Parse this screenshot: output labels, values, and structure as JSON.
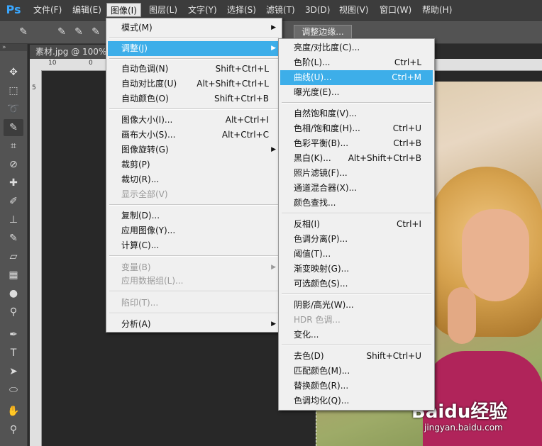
{
  "menubar": {
    "logo": "Ps",
    "items": [
      {
        "label": "文件(F)"
      },
      {
        "label": "编辑(E)"
      },
      {
        "label": "图像(I)"
      },
      {
        "label": "图层(L)"
      },
      {
        "label": "文字(Y)"
      },
      {
        "label": "选择(S)"
      },
      {
        "label": "滤镜(T)"
      },
      {
        "label": "3D(D)"
      },
      {
        "label": "视图(V)"
      },
      {
        "label": "窗口(W)"
      },
      {
        "label": "帮助(H)"
      }
    ]
  },
  "options": {
    "refine_edge": "调整边缘..."
  },
  "document": {
    "tab_label": "素材.jpg @ 100%(",
    "ruler_ticks": [
      "10",
      "0",
      "5"
    ]
  },
  "image_menu": {
    "items": [
      {
        "label": "模式(M)",
        "shortcut": "",
        "submenu": true
      },
      {
        "label": "调整(J)",
        "shortcut": "",
        "submenu": true
      },
      {
        "label": "自动色调(N)",
        "shortcut": "Shift+Ctrl+L"
      },
      {
        "label": "自动对比度(U)",
        "shortcut": "Alt+Shift+Ctrl+L"
      },
      {
        "label": "自动颜色(O)",
        "shortcut": "Shift+Ctrl+B"
      },
      {
        "label": "图像大小(I)...",
        "shortcut": "Alt+Ctrl+I"
      },
      {
        "label": "画布大小(S)...",
        "shortcut": "Alt+Ctrl+C"
      },
      {
        "label": "图像旋转(G)",
        "shortcut": "",
        "submenu": true
      },
      {
        "label": "裁剪(P)",
        "shortcut": ""
      },
      {
        "label": "裁切(R)...",
        "shortcut": ""
      },
      {
        "label": "显示全部(V)",
        "shortcut": ""
      },
      {
        "label": "复制(D)...",
        "shortcut": ""
      },
      {
        "label": "应用图像(Y)...",
        "shortcut": ""
      },
      {
        "label": "计算(C)...",
        "shortcut": ""
      },
      {
        "label": "变量(B)",
        "shortcut": "",
        "submenu": true
      },
      {
        "label": "应用数据组(L)...",
        "shortcut": ""
      },
      {
        "label": "陷印(T)...",
        "shortcut": ""
      },
      {
        "label": "分析(A)",
        "shortcut": "",
        "submenu": true
      }
    ]
  },
  "adjust_menu": {
    "items": [
      {
        "label": "亮度/对比度(C)...",
        "shortcut": ""
      },
      {
        "label": "色阶(L)...",
        "shortcut": "Ctrl+L"
      },
      {
        "label": "曲线(U)...",
        "shortcut": "Ctrl+M"
      },
      {
        "label": "曝光度(E)...",
        "shortcut": ""
      },
      {
        "label": "自然饱和度(V)...",
        "shortcut": ""
      },
      {
        "label": "色相/饱和度(H)...",
        "shortcut": "Ctrl+U"
      },
      {
        "label": "色彩平衡(B)...",
        "shortcut": "Ctrl+B"
      },
      {
        "label": "黑白(K)...",
        "shortcut": "Alt+Shift+Ctrl+B"
      },
      {
        "label": "照片滤镜(F)...",
        "shortcut": ""
      },
      {
        "label": "通道混合器(X)...",
        "shortcut": ""
      },
      {
        "label": "颜色查找...",
        "shortcut": ""
      },
      {
        "label": "反相(I)",
        "shortcut": "Ctrl+I"
      },
      {
        "label": "色调分离(P)...",
        "shortcut": ""
      },
      {
        "label": "阈值(T)...",
        "shortcut": ""
      },
      {
        "label": "渐变映射(G)...",
        "shortcut": ""
      },
      {
        "label": "可选颜色(S)...",
        "shortcut": ""
      },
      {
        "label": "阴影/高光(W)...",
        "shortcut": ""
      },
      {
        "label": "HDR 色调...",
        "shortcut": ""
      },
      {
        "label": "变化...",
        "shortcut": ""
      },
      {
        "label": "去色(D)",
        "shortcut": "Shift+Ctrl+U"
      },
      {
        "label": "匹配颜色(M)...",
        "shortcut": ""
      },
      {
        "label": "替换颜色(R)...",
        "shortcut": ""
      },
      {
        "label": "色调均化(Q)...",
        "shortcut": ""
      }
    ]
  },
  "watermark": {
    "brand": "Baidu经验",
    "url": "jingyan.baidu.com"
  }
}
